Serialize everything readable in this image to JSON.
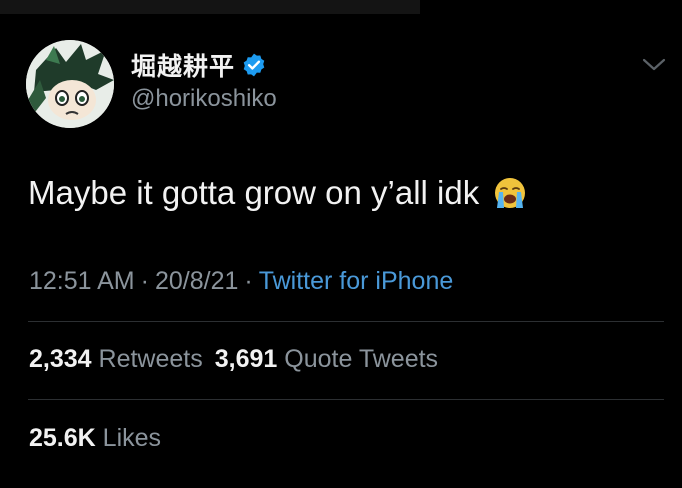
{
  "tweet": {
    "author": {
      "display_name": "堀越耕平",
      "handle": "@horikoshiko",
      "verified": true
    },
    "text": "Maybe it gotta grow on y’all idk",
    "emoji": "loudly-crying-face",
    "time": "12:51 AM",
    "date": "20/8/21",
    "separator": "·",
    "source": "Twitter for iPhone",
    "stats": {
      "retweets_count": "2,334",
      "retweets_label": "Retweets",
      "quote_tweets_count": "3,691",
      "quote_tweets_label": "Quote Tweets",
      "likes_count": "25.6K",
      "likes_label": "Likes"
    }
  },
  "colors": {
    "background": "#000000",
    "primary_text": "#f2f2f2",
    "secondary_text": "#8b949c",
    "link": "#4a99d8",
    "verified": "#1d9bf0",
    "divider": "#2c2f32"
  }
}
